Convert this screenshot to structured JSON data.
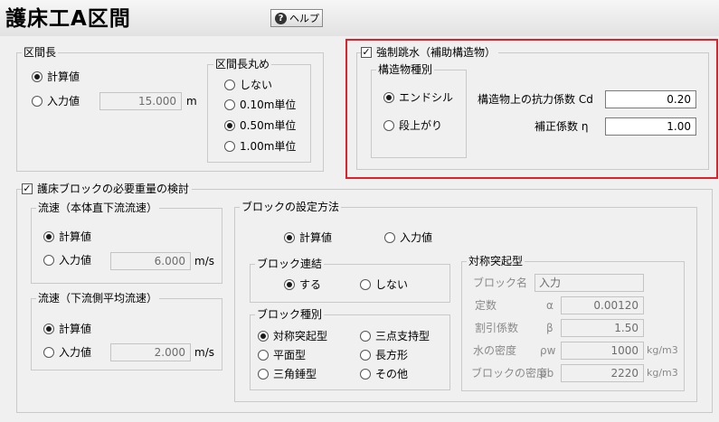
{
  "header": {
    "title": "護床工A区間",
    "help_label": "ヘルプ"
  },
  "section_length": {
    "group_label": "区間長",
    "calc_label": "計算値",
    "input_label": "入力値",
    "value": "15.000",
    "unit": "m",
    "rounding": {
      "group_label": "区間長丸め",
      "options": [
        "しない",
        "0.10m単位",
        "0.50m単位",
        "1.00m単位"
      ],
      "selected": "0.50m単位"
    }
  },
  "forced_jump": {
    "checkbox_label": "強制跳水（補助構造物）",
    "checked": true,
    "structure_type": {
      "group_label": "構造物種別",
      "options": [
        "エンドシル",
        "段上がり"
      ],
      "selected": "エンドシル"
    },
    "cd_label": "構造物上の抗力係数 Cd",
    "cd_value": "0.20",
    "eta_label": "補正係数  η",
    "eta_value": "1.00"
  },
  "block_weight": {
    "checkbox_label": "護床ブロックの必要重量の検討",
    "checked": true,
    "velocity_main": {
      "group_label": "流速（本体直下流流速）",
      "calc_label": "計算値",
      "input_label": "入力値",
      "value": "6.000",
      "unit": "m/s"
    },
    "velocity_down": {
      "group_label": "流速（下流側平均流速）",
      "calc_label": "計算値",
      "input_label": "入力値",
      "value": "2.000",
      "unit": "m/s"
    },
    "setting_method": {
      "group_label": "ブロックの設定方法",
      "calc_label": "計算値",
      "input_label": "入力値"
    },
    "connection": {
      "group_label": "ブロック連結",
      "yes_label": "する",
      "no_label": "しない"
    },
    "block_type": {
      "group_label": "ブロック種別",
      "options": [
        "対称突起型",
        "三点支持型",
        "平面型",
        "長方形",
        "三角錘型",
        "その他"
      ],
      "selected": "対称突起型"
    },
    "symmetric": {
      "group_label": "対称突起型",
      "name_label": "ブロック名",
      "name_value": "入力",
      "const_label": "定数",
      "const_symbol": "α",
      "const_value": "0.00120",
      "discount_label": "割引係数",
      "discount_symbol": "β",
      "discount_value": "1.50",
      "water_label": "水の密度",
      "water_symbol": "ρw",
      "water_value": "1000",
      "water_unit": "kg/m3",
      "block_label": "ブロックの密度",
      "block_symbol": "ρb",
      "block_value": "2220",
      "block_unit": "kg/m3"
    }
  }
}
